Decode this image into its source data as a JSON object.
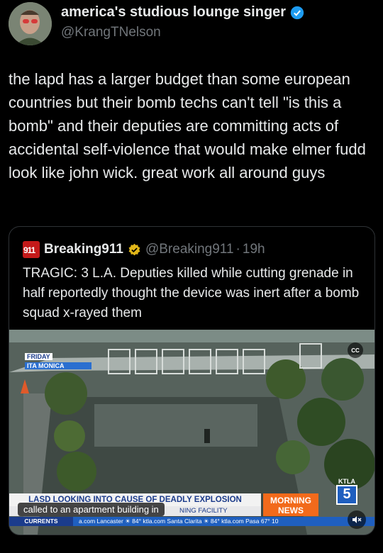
{
  "author": {
    "name": "america's studious lounge singer",
    "handle": "@KrangTNelson"
  },
  "tweet": {
    "text": "the lapd has a larger budget than some european countries but their bomb techs can't tell \"is this a bomb\" and their deputies are committing acts of accidental self-violence that would make elmer fudd look like john wick. great work all around guys"
  },
  "quote": {
    "logo_text": "911",
    "name": "Breaking911",
    "handle": "@Breaking911",
    "separator": "·",
    "time": "19h",
    "text": "TRAGIC: 3 L.A. Deputies killed while cutting grenade in half reportedly thought the device was inert after a bomb squad x-rayed them"
  },
  "video": {
    "cc_label": "CC",
    "day": "FRIDAY",
    "location": "ITA MONICA",
    "headline": "LASD LOOKING INTO CAUSE OF DEADLY EXPLOSION",
    "subline": "NING FACILITY",
    "caption": "called to an apartment building in",
    "morning_news": [
      "MORNING",
      "NEWS"
    ],
    "ticker_label": "CURRENTS",
    "ticker_items": "a.com  Lancaster  ☀ 84°  ktla.com  Santa Clarita  ☀ 84°  ktla.com  Pasa  67°  10",
    "station": "KTLA",
    "channel": "5"
  },
  "colors": {
    "verified": "#1d9bf0",
    "breaking_red": "#c41a1a",
    "ktla_blue": "#1f5fbf",
    "morning_orange": "#f26a1b"
  }
}
